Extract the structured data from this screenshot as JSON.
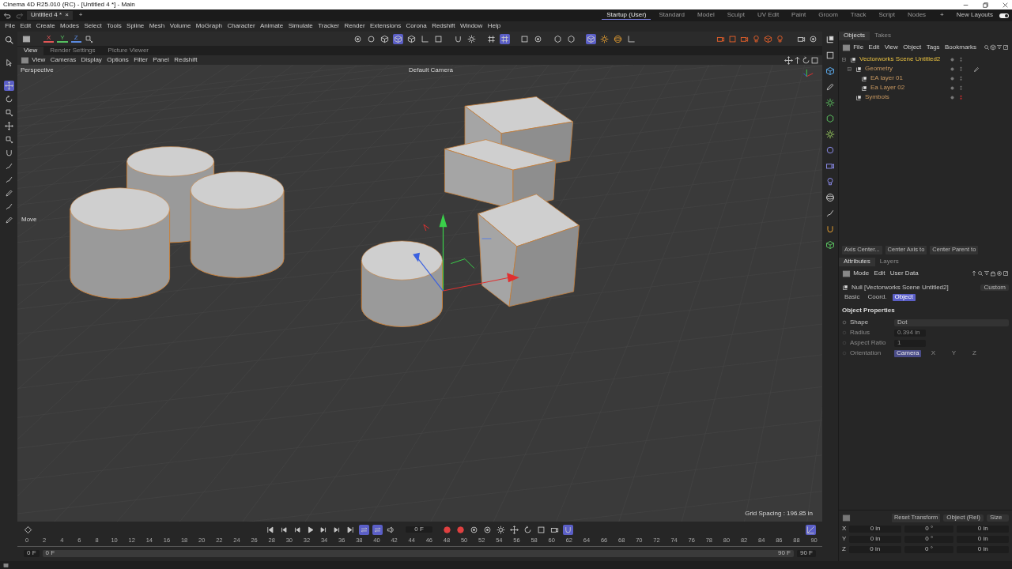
{
  "window": {
    "title": "Cinema 4D R25.010 (RC) - [Untitled 4 *] - Main"
  },
  "document_tabs": [
    {
      "label": "Untitled 4 *",
      "close": "×",
      "selected": true
    }
  ],
  "new_tab": "+",
  "layouts": [
    {
      "label": "Startup (User)",
      "selected": true
    },
    {
      "label": "Standard",
      "selected": false
    },
    {
      "label": "Model",
      "selected": false
    },
    {
      "label": "Sculpt",
      "selected": false
    },
    {
      "label": "UV Edit",
      "selected": false
    },
    {
      "label": "Paint",
      "selected": false
    },
    {
      "label": "Groom",
      "selected": false
    },
    {
      "label": "Track",
      "selected": false
    },
    {
      "label": "Script",
      "selected": false
    },
    {
      "label": "Nodes",
      "selected": false
    }
  ],
  "add_layout": "+",
  "new_layouts": {
    "label": "New Layouts",
    "on": true
  },
  "menu": [
    "File",
    "Edit",
    "Create",
    "Modes",
    "Select",
    "Tools",
    "Spline",
    "Mesh",
    "Volume",
    "MoGraph",
    "Character",
    "Animate",
    "Simulate",
    "Tracker",
    "Render",
    "Extensions",
    "Corona",
    "Redshift",
    "Window",
    "Help"
  ],
  "left_tools": [
    {
      "selected": false
    },
    {
      "selected": true
    },
    {
      "selected": false
    },
    {
      "selected": false
    },
    {
      "selected": false
    },
    {
      "selected": false
    },
    {
      "selected": false
    },
    {
      "selected": false
    },
    {
      "selected": false
    },
    {
      "selected": false
    },
    {
      "selected": false
    },
    {
      "selected": false
    }
  ],
  "axis_buttons": [
    {
      "label": "X",
      "color": "#e05555"
    },
    {
      "label": "Y",
      "color": "#55c060"
    },
    {
      "label": "Z",
      "color": "#5a8ae0"
    }
  ],
  "toolbar": [
    {
      "on": false
    },
    {
      "on": false
    },
    {
      "on": false
    },
    {
      "on": true
    },
    {
      "on": false
    },
    {
      "on": false
    },
    {
      "on": false
    },
    {
      "on": false
    },
    {
      "on": false
    },
    {
      "on": false
    },
    {
      "on": true
    },
    {
      "on": false
    },
    {
      "on": false
    },
    {
      "on": false
    },
    {
      "on": false
    },
    {
      "on": true
    },
    {
      "on": false
    },
    {
      "on": false
    },
    {
      "on": false
    }
  ],
  "view_tabs": [
    {
      "label": "View",
      "selected": true
    },
    {
      "label": "Render Settings",
      "selected": false
    },
    {
      "label": "Picture Viewer",
      "selected": false
    }
  ],
  "viewport_menu": [
    "View",
    "Cameras",
    "Display",
    "Options",
    "Filter",
    "Panel",
    "Redshift"
  ],
  "viewport": {
    "view_name": "Perspective",
    "camera": "Default Camera",
    "tool_label": "Move",
    "grid_spacing": "Grid Spacing : 196.85 in"
  },
  "object_tabs": [
    {
      "label": "Objects",
      "selected": true
    },
    {
      "label": "Takes",
      "selected": false
    }
  ],
  "object_menu": [
    "File",
    "Edit",
    "View",
    "Object",
    "Tags",
    "Bookmarks"
  ],
  "objects": [
    {
      "name": "Vectorworks Scene Untitled2",
      "selected": true,
      "hidden": false,
      "has_tag": false,
      "children": [
        {
          "name": "Geometry",
          "selected": false,
          "hidden": false,
          "has_tag": true,
          "children": [
            {
              "name": "EA layer 01",
              "selected": false,
              "hidden": false,
              "has_tag": false
            },
            {
              "name": "Ea Layer 02",
              "selected": false,
              "hidden": false,
              "has_tag": false
            }
          ]
        },
        {
          "name": "Symbols",
          "selected": false,
          "hidden": true,
          "has_tag": false
        }
      ]
    }
  ],
  "command_buttons": [
    "Axis Center...",
    "Center Axis to",
    "Center Parent to"
  ],
  "attribute_tabs": [
    {
      "label": "Attributes",
      "selected": true
    },
    {
      "label": "Layers",
      "selected": false
    }
  ],
  "attribute_menu": [
    "Mode",
    "Edit",
    "User Data"
  ],
  "object_title": "Null [Vectorworks Scene Untitled2]",
  "preset": "Custom",
  "attribute_pages": [
    {
      "label": "Basic",
      "selected": false
    },
    {
      "label": "Coord.",
      "selected": false
    },
    {
      "label": "Object",
      "selected": true
    }
  ],
  "section_title": "Object Properties",
  "properties": [
    {
      "label": "Shape",
      "kind": "dropdown",
      "value": "Dot",
      "disabled": false
    },
    {
      "label": "Radius",
      "kind": "number",
      "value": "0.394 in",
      "disabled": true
    },
    {
      "label": "Aspect Ratio",
      "kind": "number",
      "value": "1",
      "disabled": true
    },
    {
      "label": "Orientation",
      "kind": "segmented",
      "disabled": true,
      "options": [
        {
          "label": "Camera",
          "selected": true
        },
        {
          "label": "X",
          "selected": false
        },
        {
          "label": "Y",
          "selected": false
        },
        {
          "label": "Z",
          "selected": false
        }
      ]
    }
  ],
  "transform": {
    "reset": "Reset Transform",
    "mode": "Object (Rel)",
    "size_mode": "Size",
    "rows": [
      {
        "axis": "X",
        "position": "0 in",
        "rotation": "0 °",
        "size": "0 in"
      },
      {
        "axis": "Y",
        "position": "0 in",
        "rotation": "0 °",
        "size": "0 in"
      },
      {
        "axis": "Z",
        "position": "0 in",
        "rotation": "0 °",
        "size": "0 in"
      }
    ]
  },
  "timeline": {
    "transport": [
      {
        "on": false
      },
      {
        "on": false
      },
      {
        "on": false
      },
      {
        "on": false
      },
      {
        "on": false
      },
      {
        "on": false
      },
      {
        "on": false
      },
      {
        "on": true
      },
      {
        "on": true
      },
      {
        "on": false
      }
    ],
    "current_frame": "0 F",
    "record_tools": [
      {
        "on": false
      },
      {
        "on": false
      },
      {
        "on": false
      },
      {
        "on": false
      },
      {
        "on": false
      },
      {
        "on": false
      },
      {
        "on": false
      },
      {
        "on": false
      },
      {
        "on": false
      },
      {
        "on": true
      }
    ],
    "graph_on": true,
    "ticks": [
      "0",
      "2",
      "4",
      "6",
      "8",
      "10",
      "12",
      "14",
      "16",
      "18",
      "20",
      "22",
      "24",
      "26",
      "28",
      "30",
      "32",
      "34",
      "36",
      "38",
      "40",
      "42",
      "44",
      "46",
      "48",
      "50",
      "52",
      "54",
      "56",
      "58",
      "60",
      "62",
      "64",
      "66",
      "68",
      "70",
      "72",
      "74",
      "76",
      "78",
      "80",
      "82",
      "84",
      "86",
      "88",
      "90"
    ],
    "start": "0 F",
    "range_start": "0 F",
    "range_end": "90 F",
    "end": "90 F"
  }
}
